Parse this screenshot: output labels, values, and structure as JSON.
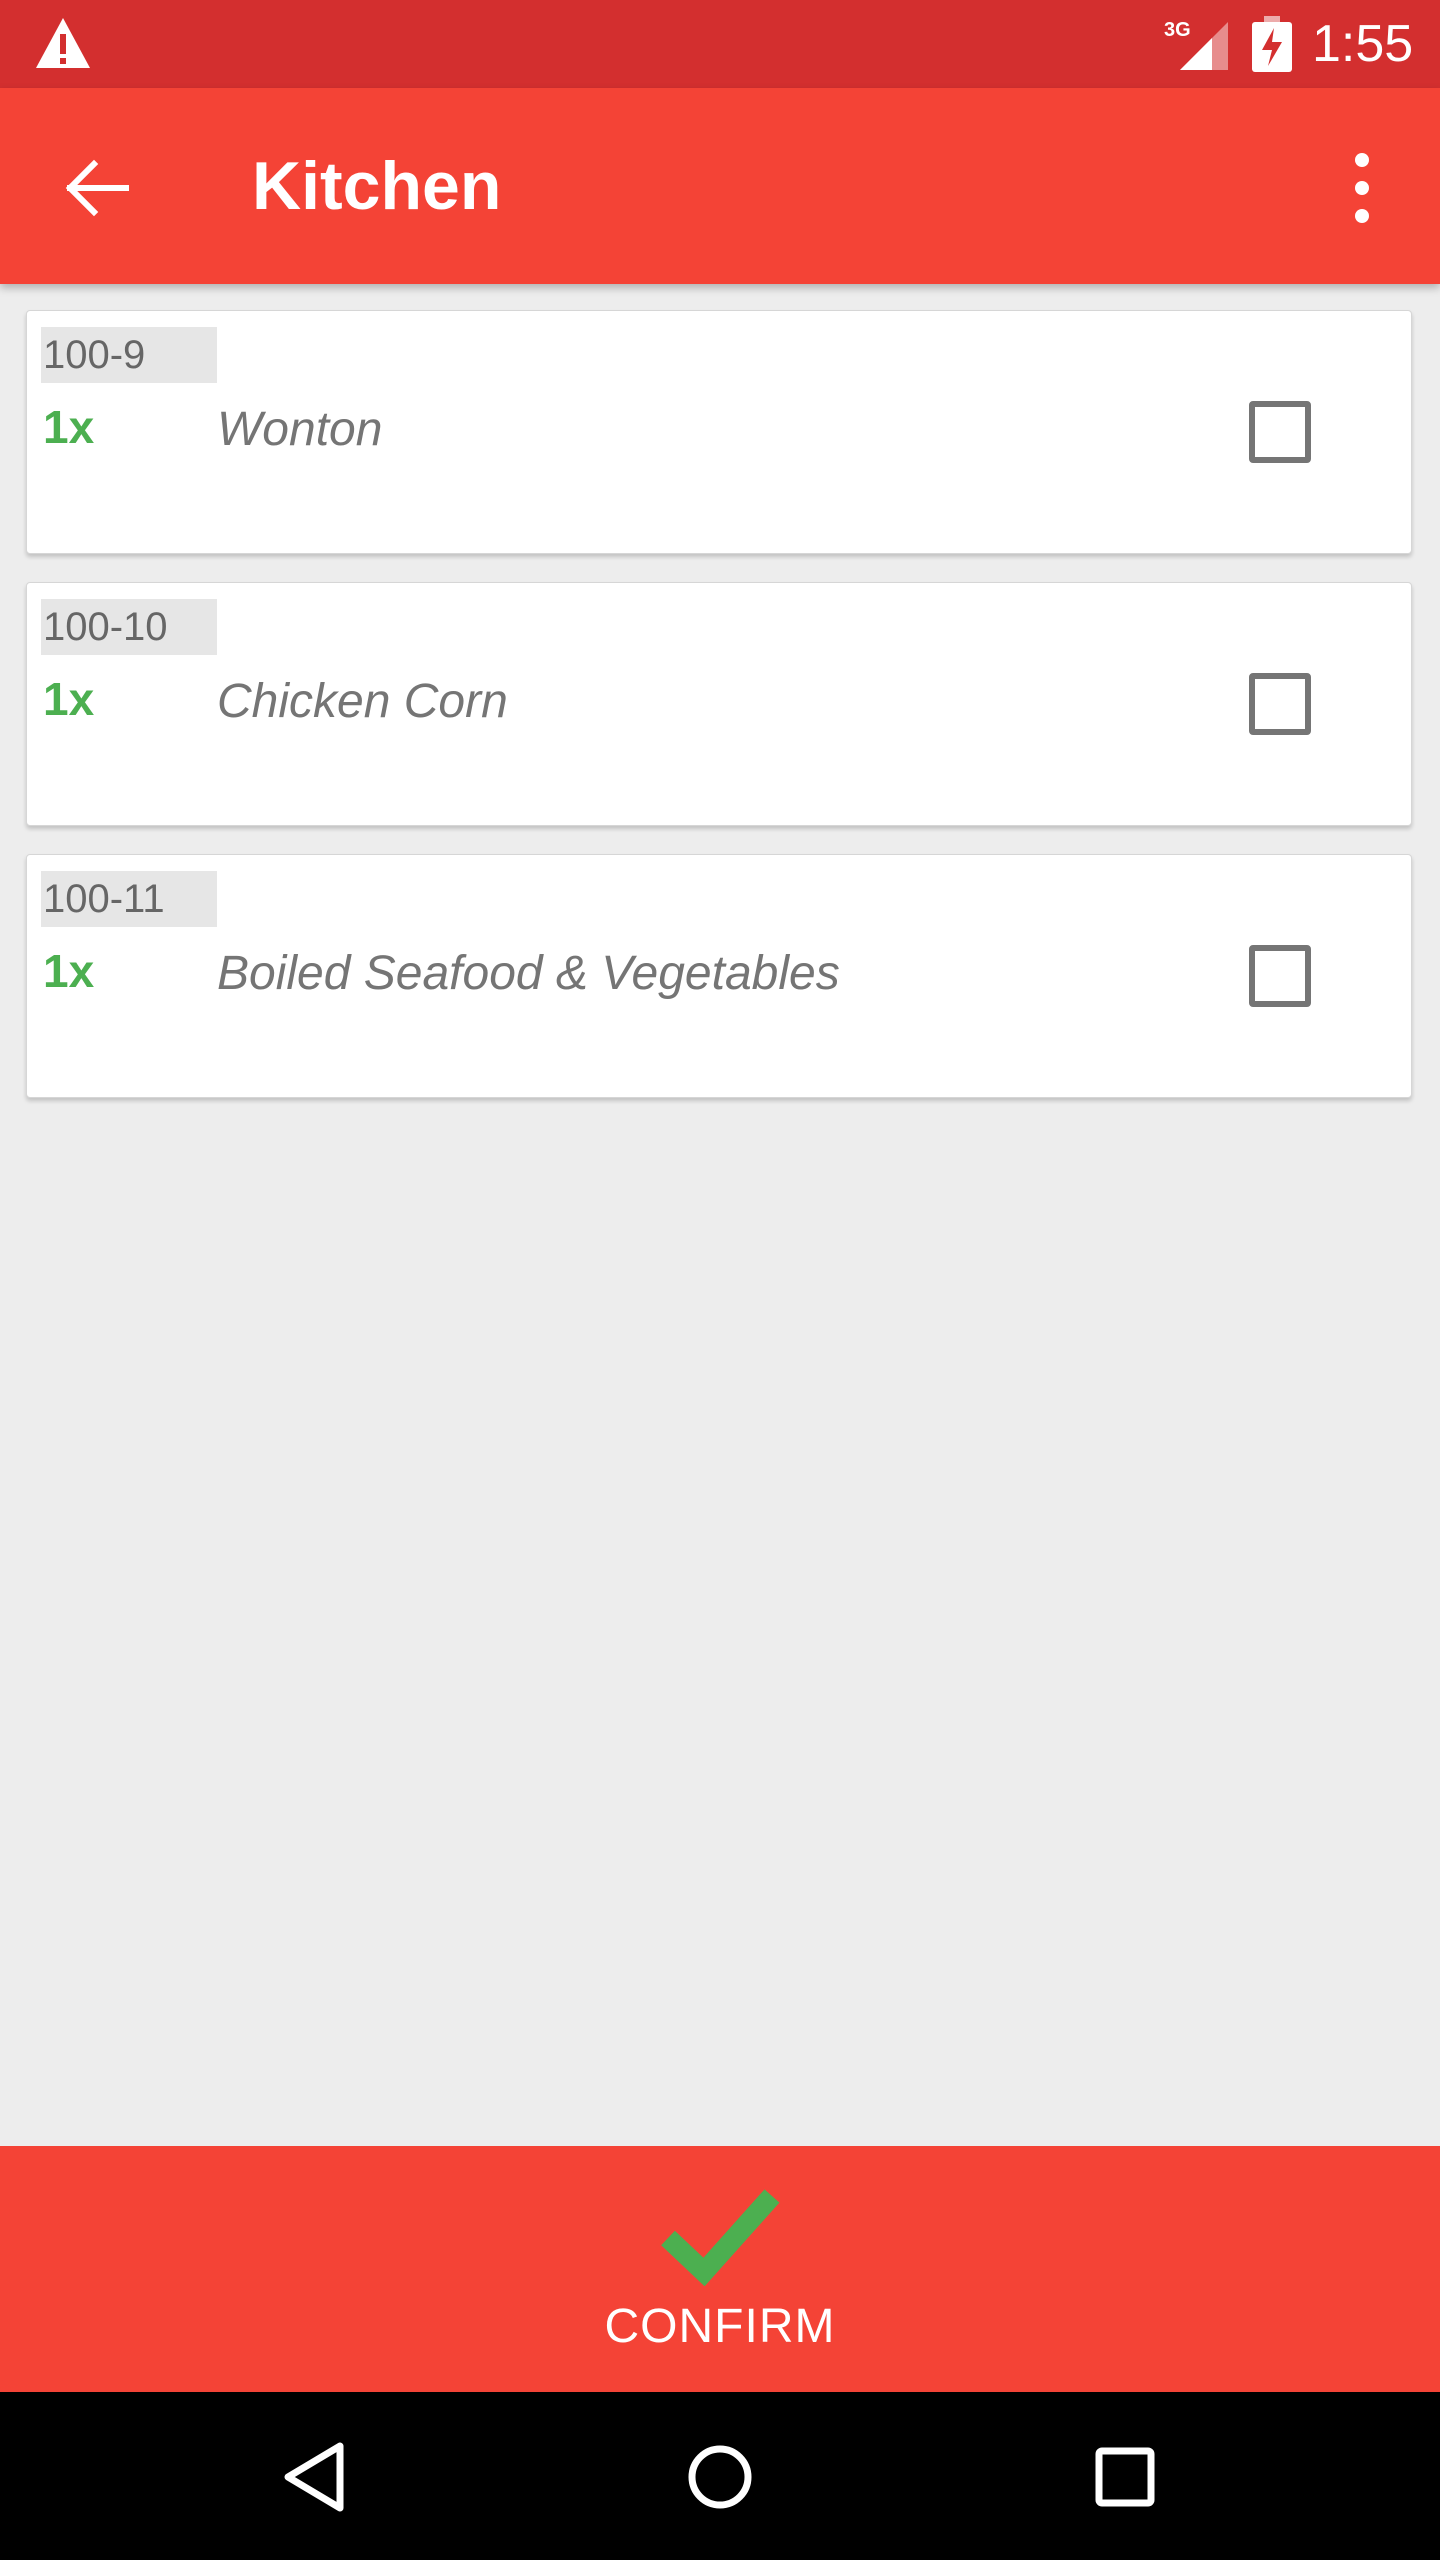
{
  "status_bar": {
    "network": "3G",
    "time": "1:55",
    "icons": [
      "warning-icon",
      "signal-icon",
      "battery-charging-icon"
    ]
  },
  "app_bar": {
    "title": "Kitchen",
    "icons": [
      "arrow-back-icon",
      "more-vert-icon"
    ]
  },
  "items": [
    {
      "code": "100-9",
      "qty": "1x",
      "name": "Wonton",
      "checked": false
    },
    {
      "code": "100-10",
      "qty": "1x",
      "name": "Chicken Corn",
      "checked": false
    },
    {
      "code": "100-11",
      "qty": "1x",
      "name": "Boiled Seafood & Vegetables",
      "checked": false
    }
  ],
  "confirm": {
    "label": "CONFIRM",
    "icon": "check-icon"
  },
  "nav_bar": {
    "icons": [
      "nav-back-icon",
      "nav-home-icon",
      "nav-recents-icon"
    ]
  },
  "colors": {
    "status_bar": "#d32f2f",
    "app_bar": "#f44336",
    "qty_green": "#4caf50",
    "check_green": "#4caf50",
    "background": "#ededed"
  }
}
